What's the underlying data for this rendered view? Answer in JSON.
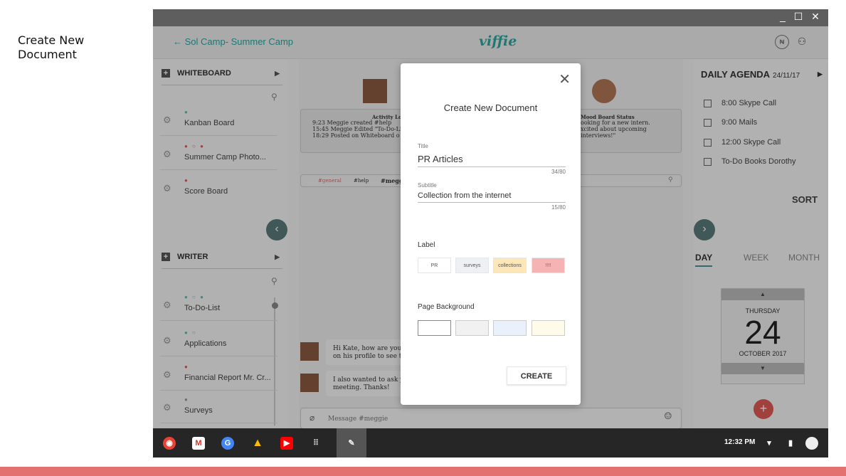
{
  "caption": "Create New Document",
  "window": {
    "controls": {
      "minimize": "_",
      "maximize": "☐",
      "close": "✕"
    }
  },
  "appbar": {
    "back_label": "←  Sol Camp- Summer Camp",
    "logo": "viffie",
    "icons": [
      "menu-badge-icon",
      "user-settings-icon"
    ]
  },
  "left_sidebar": {
    "whiteboard": {
      "header": "WHITEBOARD",
      "items": [
        {
          "name": "Kanban Board",
          "dots": "●"
        },
        {
          "name": "Summer Camp Photo...",
          "dots": "● ○ ●"
        },
        {
          "name": "Score Board",
          "dots": "●"
        }
      ]
    },
    "writer": {
      "header": "WRITER",
      "items": [
        {
          "name": "To-Do-List",
          "dots": "● ○ ●"
        },
        {
          "name": "Applications",
          "dots": "● ○"
        },
        {
          "name": "Financial Report Mr. Cr...",
          "dots": "●"
        },
        {
          "name": "Surveys",
          "dots": "●"
        }
      ]
    }
  },
  "center": {
    "activity_title": "Activity Log",
    "activity_lines": [
      "9:23 Meggie created #help",
      "15:45 Meggie Edited \"To-Do-Li",
      "18:29 Posted on Whiteboard o"
    ],
    "mood_title": "Mood Board Status",
    "mood_lines": [
      "ooking for a new intern.",
      "xcited about upcoming",
      " interviews!\""
    ],
    "channels": [
      "#general",
      "#help",
      "#meggi"
    ],
    "messages": [
      {
        "text": "Hi Kate, how are you d",
        "text2": "on his profile to see the"
      },
      {
        "text": "I also wanted to ask yo",
        "text2": "meeting. Thanks!"
      }
    ],
    "message_placeholder": "Message #meggie"
  },
  "right_sidebar": {
    "agenda_title": "DAILY AGENDA",
    "agenda_date": "24/11/17",
    "items": [
      "8:00 Skype Call",
      "9:00 Mails",
      "12:00 Skype Call",
      "To-Do Books Dorothy"
    ],
    "sort_label": "SORT",
    "tabs": [
      "DAY",
      "WEEK",
      "MONTH"
    ],
    "calendar": {
      "weekday": "THURSDAY",
      "day": "24",
      "month": "OCTOBER 2017"
    }
  },
  "shelf": {
    "apps": [
      "chrome-icon",
      "gmail-icon",
      "google-icon",
      "drive-icon",
      "youtube-icon",
      "launcher-icon",
      "viffie-icon"
    ],
    "clock": "12:32 PM"
  },
  "modal": {
    "title": "Create New Document",
    "title_label": "Title",
    "title_value": "PR Articles",
    "title_counter": "34/80",
    "subtitle_label": "Subtitle",
    "subtitle_value": "Collection from the internet",
    "subtitle_counter": "15/80",
    "label_section": "Label",
    "labels": [
      {
        "text": "PR",
        "color": "#ffffff"
      },
      {
        "text": "surveys",
        "color": "#eef1f4"
      },
      {
        "text": "collections",
        "color": "#fde6b8"
      },
      {
        "text": "!!!!",
        "color": "#f6b3b3"
      }
    ],
    "background_section": "Page Background",
    "backgrounds": [
      "#ffffff",
      "#f1f1f1",
      "#eaf1fb",
      "#fffbea"
    ],
    "create_label": "CREATE"
  },
  "colors": {
    "accent": "#2aa7a0",
    "bottom_bar": "#e2716f",
    "fab": "#e05a55"
  }
}
